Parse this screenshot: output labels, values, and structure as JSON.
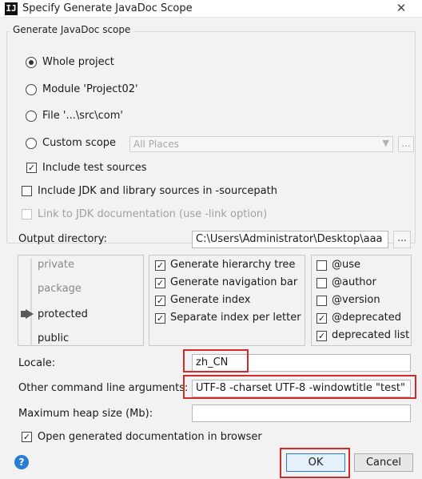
{
  "window": {
    "title": "Specify Generate JavaDoc Scope",
    "app_icon": "IJ",
    "close_glyph": "✕"
  },
  "scope": {
    "group_title": "Generate JavaDoc scope",
    "options": [
      {
        "label": "Whole project",
        "selected": true
      },
      {
        "label": "Module 'Project02'",
        "selected": false
      },
      {
        "label": "File '...\\src\\com'",
        "selected": false
      },
      {
        "label": "Custom scope",
        "selected": false
      }
    ],
    "custom_scope_value": "All Places",
    "custom_scope_more": "...",
    "include_test_sources": {
      "label": "Include test sources",
      "checked": true
    }
  },
  "options": {
    "include_jdk": {
      "label": "Include JDK and library sources in -sourcepath",
      "checked": false
    },
    "link_jdk": {
      "label": "Link to JDK documentation (use -link option)",
      "checked": false,
      "enabled": false
    }
  },
  "output": {
    "label": "Output directory:",
    "value": "C:\\Users\\Administrator\\Desktop\\aaa",
    "browse_label": "..."
  },
  "visibility": {
    "levels": [
      "private",
      "package",
      "protected",
      "public"
    ],
    "selected": "protected"
  },
  "generate": [
    {
      "label": "Generate hierarchy tree",
      "checked": true
    },
    {
      "label": "Generate navigation bar",
      "checked": true
    },
    {
      "label": "Generate index",
      "checked": true
    },
    {
      "label": "Separate index per letter",
      "checked": true
    }
  ],
  "tags": [
    {
      "label": "@use",
      "checked": false
    },
    {
      "label": "@author",
      "checked": false
    },
    {
      "label": "@version",
      "checked": false
    },
    {
      "label": "@deprecated",
      "checked": true
    },
    {
      "label": "deprecated list",
      "checked": true
    }
  ],
  "locale": {
    "label": "Locale:",
    "value": "zh_CN"
  },
  "other_args": {
    "label": "Other command line arguments:",
    "value": "UTF-8 -charset UTF-8 -windowtitle \"test\""
  },
  "heap": {
    "label": "Maximum heap size (Mb):",
    "value": ""
  },
  "open_browser": {
    "label": "Open generated documentation in browser",
    "checked": true
  },
  "buttons": {
    "help": "?",
    "ok": "OK",
    "cancel": "Cancel"
  },
  "check_glyph": "✓",
  "colors": {
    "highlight_border": "#d12a2a",
    "help_icon": "#2a7bd4"
  }
}
